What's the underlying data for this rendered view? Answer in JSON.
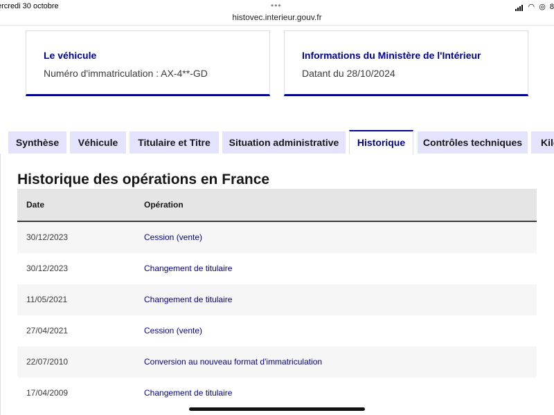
{
  "status_bar": {
    "date": "ercredi 30 octobre",
    "url": "histovec.interieur.gouv.fr",
    "battery_text": "8"
  },
  "cards": [
    {
      "title": "Le véhicule",
      "text": "Numéro d'immatriculation : AX-4**-GD"
    },
    {
      "title": "Informations du Ministère de l'Intérieur",
      "text": "Datant du 28/10/2024"
    }
  ],
  "tabs": [
    {
      "label": "Synthèse",
      "active": false
    },
    {
      "label": "Véhicule",
      "active": false
    },
    {
      "label": "Titulaire et Titre",
      "active": false
    },
    {
      "label": "Situation administrative",
      "active": false
    },
    {
      "label": "Historique",
      "active": true
    },
    {
      "label": "Contrôles techniques",
      "active": false
    },
    {
      "label": "Kilo",
      "active": false
    }
  ],
  "section_title": "Historique des opérations en France",
  "table": {
    "headers": [
      "Date",
      "Opération"
    ],
    "rows": [
      {
        "date": "30/12/2023",
        "operation": "Cession (vente)"
      },
      {
        "date": "30/12/2023",
        "operation": "Changement de titulaire"
      },
      {
        "date": "11/05/2021",
        "operation": "Changement de titulaire"
      },
      {
        "date": "27/04/2021",
        "operation": "Cession (vente)"
      },
      {
        "date": "22/07/2010",
        "operation": "Conversion au nouveau format d'immatriculation"
      },
      {
        "date": "17/04/2009",
        "operation": "Changement de titulaire"
      }
    ]
  },
  "colors": {
    "accent": "#000091",
    "tab_bg": "#e3e3fd",
    "header_bg": "#e5e5e5",
    "row_alt": "#f6f6f6"
  }
}
